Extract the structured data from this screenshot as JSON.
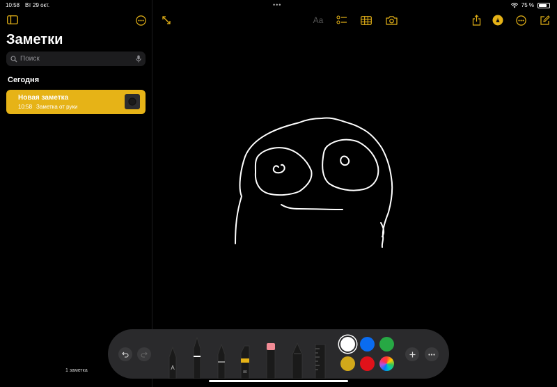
{
  "status": {
    "time": "10:58",
    "date": "Вт 29 окт.",
    "battery_text": "75 %",
    "battery_level": 0.75
  },
  "sidebar": {
    "title": "Заметки",
    "search_placeholder": "Поиск",
    "section": "Сегодня",
    "notes": [
      {
        "title": "Новая заметка",
        "time": "10:58",
        "preview": "Заметка от руки"
      }
    ],
    "count_label": "1 заметка"
  },
  "toolbar": {
    "format_label": "Aa"
  },
  "colors": {
    "accent": "#e6b317",
    "swatches": [
      "#ffffff",
      "#0a6cf0",
      "#27a844",
      "#d1a81a",
      "#e0121a",
      "rainbow"
    ]
  },
  "tools": [
    "monoline-pen",
    "pen",
    "fineliner",
    "marker",
    "eraser",
    "pencil",
    "ruler"
  ],
  "tool_letters": {
    "pen": "A",
    "marker": "80"
  }
}
